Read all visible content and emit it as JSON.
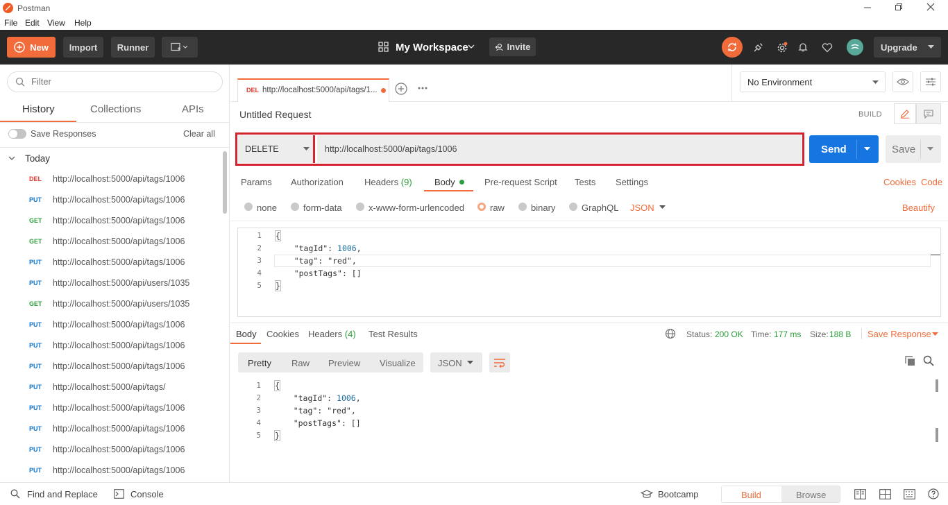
{
  "window": {
    "title": "Postman"
  },
  "menu": [
    "File",
    "Edit",
    "View",
    "Help"
  ],
  "header": {
    "new_label": "New",
    "import_label": "Import",
    "runner_label": "Runner",
    "workspace_label": "My Workspace",
    "invite_label": "Invite",
    "upgrade_label": "Upgrade"
  },
  "sidebar": {
    "filter_placeholder": "Filter",
    "tabs": [
      "History",
      "Collections",
      "APIs"
    ],
    "save_responses_label": "Save Responses",
    "clear_all_label": "Clear all",
    "group_label": "Today",
    "items": [
      {
        "method": "DEL",
        "url": "http://localhost:5000/api/tags/1006"
      },
      {
        "method": "PUT",
        "url": "http://localhost:5000/api/tags/1006"
      },
      {
        "method": "GET",
        "url": "http://localhost:5000/api/tags/1006"
      },
      {
        "method": "GET",
        "url": "http://localhost:5000/api/tags/1006"
      },
      {
        "method": "PUT",
        "url": "http://localhost:5000/api/tags/1006"
      },
      {
        "method": "PUT",
        "url": "http://localhost:5000/api/users/1035"
      },
      {
        "method": "GET",
        "url": "http://localhost:5000/api/users/1035"
      },
      {
        "method": "PUT",
        "url": "http://localhost:5000/api/tags/1006"
      },
      {
        "method": "PUT",
        "url": "http://localhost:5000/api/tags/1006"
      },
      {
        "method": "PUT",
        "url": "http://localhost:5000/api/tags/1006"
      },
      {
        "method": "PUT",
        "url": "http://localhost:5000/api/tags/"
      },
      {
        "method": "PUT",
        "url": "http://localhost:5000/api/tags/1006"
      },
      {
        "method": "PUT",
        "url": "http://localhost:5000/api/tags/1006"
      },
      {
        "method": "PUT",
        "url": "http://localhost:5000/api/tags/1006"
      },
      {
        "method": "PUT",
        "url": "http://localhost:5000/api/tags/1006"
      }
    ]
  },
  "colors": {
    "DEL": "#e5352c",
    "PUT": "#0f74c9",
    "GET": "#2c9e3b",
    "accent": "#f26b3a",
    "send": "#1675e0"
  },
  "request_tab": {
    "method": "DEL",
    "title": "http://localhost:5000/api/tags/1..."
  },
  "environment": {
    "selected": "No Environment"
  },
  "request": {
    "name": "Untitled Request",
    "build_label": "BUILD",
    "method": "DELETE",
    "url": "http://localhost:5000/api/tags/1006",
    "send_label": "Send",
    "save_label": "Save"
  },
  "req_tabs": {
    "params": "Params",
    "authorization": "Authorization",
    "headers": "Headers",
    "headers_count": "(9)",
    "body": "Body",
    "prerequest": "Pre-request Script",
    "tests": "Tests",
    "settings": "Settings",
    "cookies": "Cookies",
    "code": "Code"
  },
  "body_modes": {
    "none": "none",
    "form_data": "form-data",
    "urlencoded": "x-www-form-urlencoded",
    "raw": "raw",
    "binary": "binary",
    "graphql": "GraphQL",
    "format": "JSON",
    "beautify": "Beautify"
  },
  "request_body": {
    "line_numbers": [
      "1",
      "2",
      "3",
      "4",
      "5"
    ],
    "l1": "{",
    "l2_key": "\"tagId\"",
    "l2_sep": ": ",
    "l2_val": "1006",
    "l2_end": ",",
    "l3_key": "\"tag\"",
    "l3_sep": ": ",
    "l3_val": "\"red\"",
    "l3_end": ",",
    "l4_key": "\"postTags\"",
    "l4_rest": ": []",
    "l5": "}"
  },
  "response": {
    "tabs": {
      "body": "Body",
      "cookies": "Cookies",
      "headers": "Headers",
      "headers_count": "(4)",
      "tests": "Test Results"
    },
    "status_label": "Status:",
    "status_value": "200 OK",
    "time_label": "Time:",
    "time_value": "177 ms",
    "size_label": "Size:",
    "size_value": "188 B",
    "save_response_label": "Save Response",
    "views": {
      "pretty": "Pretty",
      "raw": "Raw",
      "preview": "Preview",
      "visualize": "Visualize"
    },
    "format": "JSON"
  },
  "footer": {
    "find_replace": "Find and Replace",
    "console": "Console",
    "bootcamp": "Bootcamp",
    "build": "Build",
    "browse": "Browse"
  }
}
